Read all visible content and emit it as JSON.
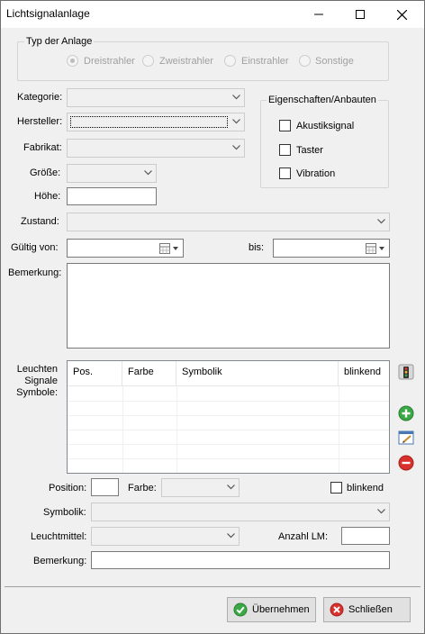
{
  "window": {
    "title": "Lichtsignalanlage"
  },
  "type_group": {
    "title": "Typ der Anlage",
    "options": [
      {
        "label": "Dreistrahler",
        "checked": true
      },
      {
        "label": "Zweistrahler",
        "checked": false
      },
      {
        "label": "Einstrahler",
        "checked": false
      },
      {
        "label": "Sonstige",
        "checked": false
      }
    ]
  },
  "fields": {
    "kategorie_label": "Kategorie:",
    "hersteller_label": "Hersteller:",
    "fabrikat_label": "Fabrikat:",
    "groesse_label": "Größe:",
    "hoehe_label": "Höhe:",
    "zustand_label": "Zustand:",
    "gueltig_von_label": "Gültig von:",
    "bis_label": "bis:",
    "bemerkung_label": "Bemerkung:"
  },
  "properties_group": {
    "title": "Eigenschaften/Anbauten",
    "items": [
      {
        "label": "Akustiksignal",
        "checked": false
      },
      {
        "label": "Taster",
        "checked": false
      },
      {
        "label": "Vibration",
        "checked": false
      }
    ]
  },
  "lights": {
    "label_line1": "Leuchten",
    "label_line2": "Signale",
    "label_line3": "Symbole:",
    "columns": [
      "Pos.",
      "Farbe",
      "Symbolik",
      "blinkend"
    ],
    "position_label": "Position:",
    "farbe_label": "Farbe:",
    "blinkend_label": "blinkend",
    "symbolik_label": "Symbolik:",
    "leuchtmittel_label": "Leuchtmittel:",
    "anzahl_lm_label": "Anzahl LM:",
    "bemerkung_label": "Bemerkung:"
  },
  "buttons": {
    "apply_label": "Übernehmen",
    "close_label": "Schließen"
  },
  "colors": {
    "accent_green": "#3aa845",
    "accent_red": "#d8302c"
  }
}
